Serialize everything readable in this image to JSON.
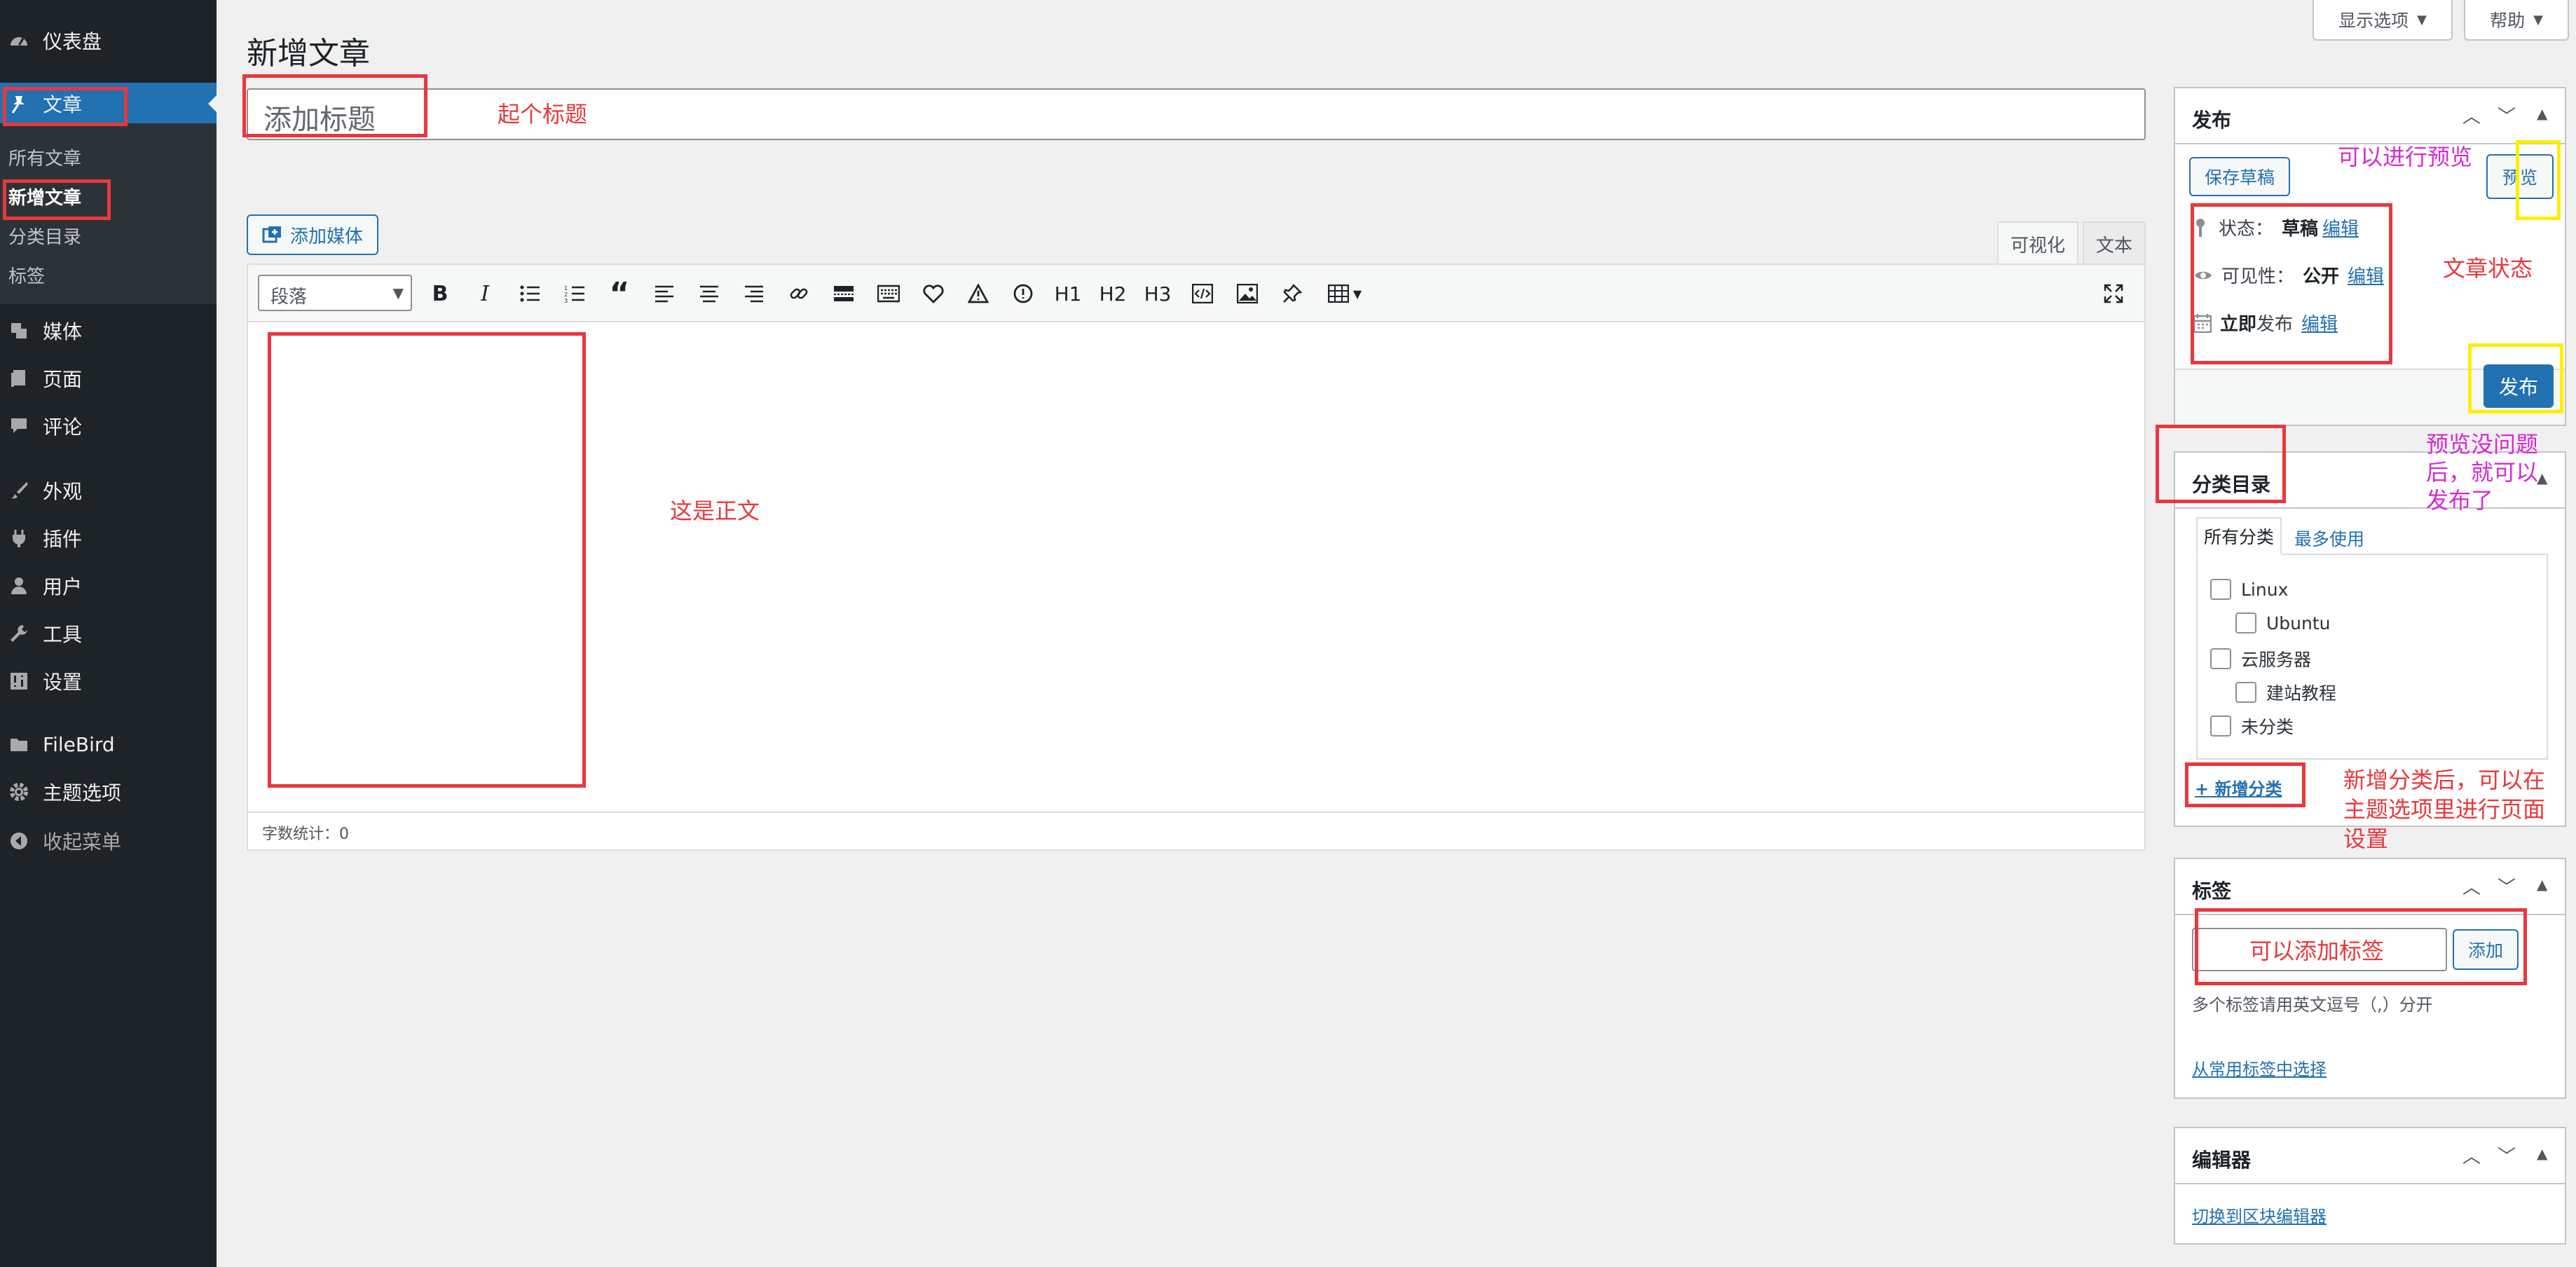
{
  "sidebar": {
    "menu": [
      {
        "label": "仪表盘",
        "icon": "dashboard-icon"
      },
      {
        "label": "文章",
        "icon": "pin-icon"
      },
      {
        "label": "媒体",
        "icon": "media-icon"
      },
      {
        "label": "页面",
        "icon": "page-icon"
      },
      {
        "label": "评论",
        "icon": "comment-icon"
      },
      {
        "label": "外观",
        "icon": "brush-icon"
      },
      {
        "label": "插件",
        "icon": "plugin-icon"
      },
      {
        "label": "用户",
        "icon": "user-icon"
      },
      {
        "label": "工具",
        "icon": "wrench-icon"
      },
      {
        "label": "设置",
        "icon": "settings-icon"
      },
      {
        "label": "FileBird",
        "icon": "folder-icon"
      },
      {
        "label": "主题选项",
        "icon": "gear-icon"
      },
      {
        "label": "收起菜单",
        "icon": "collapse-icon"
      }
    ],
    "submenu": [
      "所有文章",
      "新增文章",
      "分类目录",
      "标签"
    ]
  },
  "topbar": {
    "screen_options": "显示选项",
    "help": "帮助"
  },
  "page": {
    "title": "新增文章",
    "title_placeholder": "添加标题"
  },
  "editor": {
    "add_media": "添加媒体",
    "tab_visual": "可视化",
    "tab_text": "文本",
    "format_select": "段落",
    "word_count": "字数统计：0",
    "toolbar_headings": [
      "H1",
      "H2",
      "H3"
    ]
  },
  "publish": {
    "title": "发布",
    "save_draft": "保存草稿",
    "preview": "预览",
    "status_label": "状态：",
    "status_value": "草稿",
    "visibility_label": "可见性：",
    "visibility_value": "公开",
    "schedule_bold": "立即",
    "schedule_text": "发布",
    "edit": "编辑",
    "publish_button": "发布"
  },
  "categories": {
    "title": "分类目录",
    "tab_all": "所有分类",
    "tab_popular": "最多使用",
    "items": [
      {
        "label": "Linux",
        "indent": 0
      },
      {
        "label": "Ubuntu",
        "indent": 1
      },
      {
        "label": "云服务器",
        "indent": 0
      },
      {
        "label": "建站教程",
        "indent": 1
      },
      {
        "label": "未分类",
        "indent": 0
      }
    ],
    "add_new": "+ 新增分类"
  },
  "tags": {
    "title": "标签",
    "add_button": "添加",
    "hint": "多个标签请用英文逗号（,）分开",
    "choose_popular": "从常用标签中选择"
  },
  "editor_box": {
    "title": "编辑器",
    "switch_link": "切换到区块编辑器"
  },
  "annotations": {
    "title_note": "起个标题",
    "body_note": "这是正文",
    "preview_note": "可以进行预览",
    "status_note": "文章状态",
    "publish_note": [
      "预览没问题",
      "后，就可以",
      "发布了"
    ],
    "category_note": [
      "新增分类后，可以在",
      "主题选项里进行页面",
      "设置"
    ],
    "tag_note": "可以添加标签"
  },
  "colors": {
    "accent": "#2271b1",
    "sidebar": "#1d2327",
    "annotation_red": "#e8383d",
    "annotation_magenta": "#d62ad0",
    "annotation_yellow": "#ffee00"
  }
}
